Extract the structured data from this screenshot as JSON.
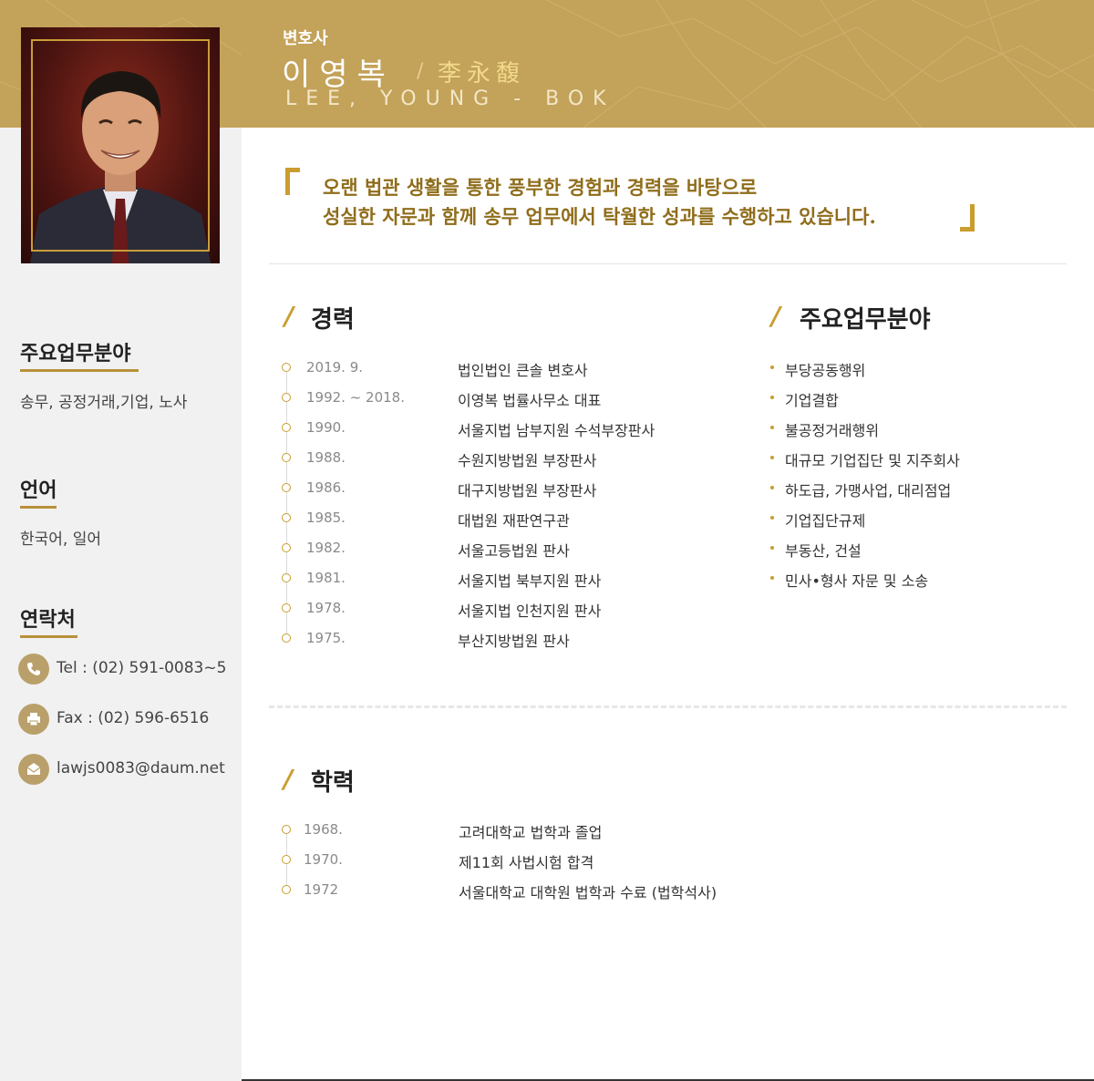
{
  "header": {
    "role": "변호사",
    "name_ko": "이영복",
    "name_separator": "/",
    "name_hanja": "李永馥",
    "name_en": "LEE, YOUNG - BOK"
  },
  "sidebar": {
    "practice_title": "주요업무분야",
    "practice_text": "송무, 공정거래,기업, 노사",
    "language_title": "언어",
    "language_text": "한국어, 일어",
    "contact_title": "연락처",
    "contacts": [
      {
        "icon": "phone-icon",
        "text": "Tel : (02) 591-0083~5"
      },
      {
        "icon": "fax-icon",
        "text": "Fax : (02) 596-6516"
      },
      {
        "icon": "mail-icon",
        "text": "lawjs0083@daum.net"
      }
    ]
  },
  "quote": {
    "line1": "오랜 법관 생활을 통한 풍부한 경험과 경력을 바탕으로",
    "line2": "성실한 자문과 함께 송무 업무에서 탁월한 성과를 수행하고 있습니다."
  },
  "career": {
    "title": "경력",
    "items": [
      {
        "year": "2019. 9.",
        "desc": "법인법인 큰솔 변호사"
      },
      {
        "year": "1992. ~ 2018.",
        "desc": "이영복 법률사무소 대표"
      },
      {
        "year": "1990.",
        "desc": "서울지법 남부지원 수석부장판사"
      },
      {
        "year": "1988.",
        "desc": "수원지방법원 부장판사"
      },
      {
        "year": "1986.",
        "desc": "대구지방법원 부장판사"
      },
      {
        "year": "1985.",
        "desc": "대법원 재판연구관"
      },
      {
        "year": "1982.",
        "desc": "서울고등법원 판사"
      },
      {
        "year": "1981.",
        "desc": "서울지법 북부지원 판사"
      },
      {
        "year": "1978.",
        "desc": "서울지법 인천지원 판사"
      },
      {
        "year": "1975.",
        "desc": "부산지방법원 판사"
      }
    ]
  },
  "areas": {
    "title": "주요업무분야",
    "items": [
      "부당공동행위",
      "기업결합",
      "불공정거래행위",
      "대규모 기업집단 및 지주회사",
      "하도급, 가맹사업, 대리점업",
      "기업집단규제",
      "부동산, 건설",
      "민사•형사 자문 및 소송"
    ]
  },
  "education": {
    "title": "학력",
    "items": [
      {
        "year": "1968.",
        "desc": "고려대학교 법학과 졸업"
      },
      {
        "year": "1970.",
        "desc": "제11회 사법시험 합격"
      },
      {
        "year": "1972",
        "desc": "서울대학교 대학원 법학과 수료 (법학석사)"
      }
    ]
  },
  "colors": {
    "header_gold": "#c3a259",
    "accent_gold": "#c99d2e",
    "quote_text": "#8f6d1b",
    "sidebar_bg": "#f1f1f1"
  }
}
